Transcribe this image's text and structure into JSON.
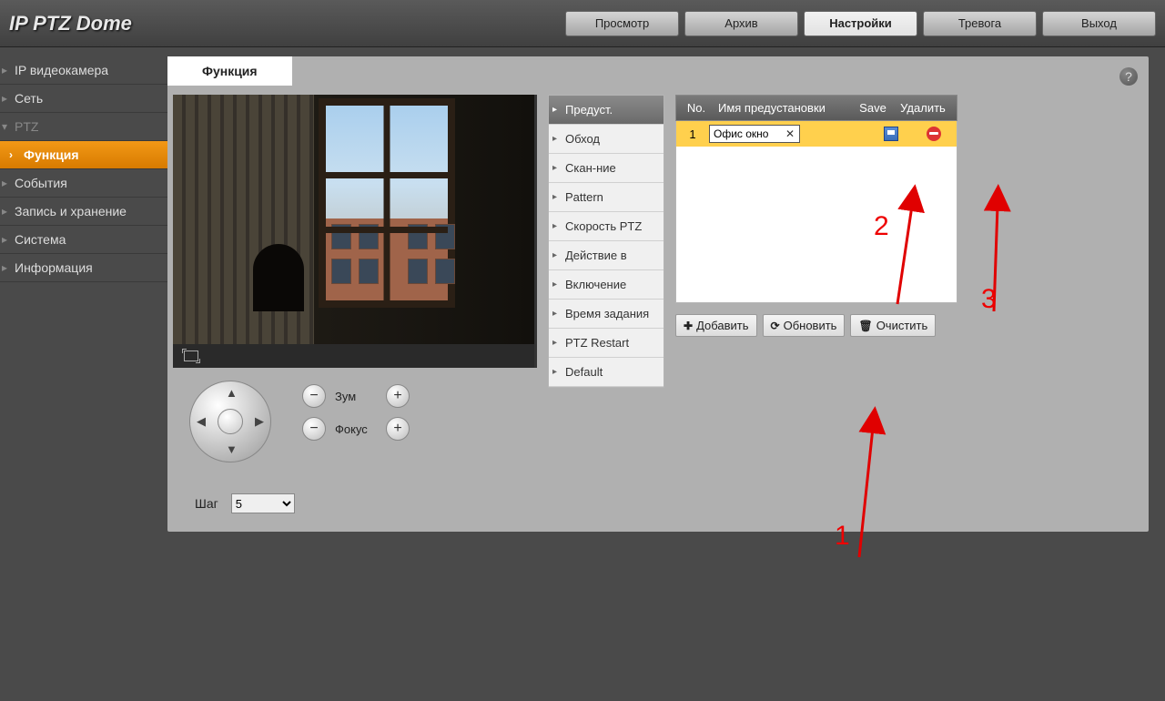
{
  "brand": "IP PTZ Dome",
  "topnav": {
    "preview": "Просмотр",
    "archive": "Архив",
    "settings": "Настройки",
    "alarm": "Тревога",
    "exit": "Выход"
  },
  "sidebar": {
    "camera": "IP видеокамера",
    "network": "Сеть",
    "ptz": "PTZ",
    "function": "Функция",
    "events": "События",
    "storage": "Запись и хранение",
    "system": "Система",
    "info": "Информация"
  },
  "tab": {
    "function": "Функция"
  },
  "ptz_menu": {
    "preset": "Предуст.",
    "tour": "Обход",
    "scan": "Скан-ние",
    "pattern": "Pattern",
    "speed": "Скорость PTZ",
    "action": "Действие в",
    "enable": "Включение",
    "timetask": "Время задания",
    "restart": "PTZ Restart",
    "default": "Default"
  },
  "controls": {
    "zoom": "Зум",
    "focus": "Фокус",
    "step": "Шаг",
    "step_value": "5"
  },
  "preset_table": {
    "headers": {
      "no": "No.",
      "name": "Имя предустановки",
      "save": "Save",
      "delete": "Удалить"
    },
    "rows": [
      {
        "no": "1",
        "name": "Офис окно"
      }
    ]
  },
  "buttons": {
    "add": "Добавить",
    "refresh": "Обновить",
    "clear": "Очистить"
  },
  "annotations": {
    "a1": "1",
    "a2": "2",
    "a3": "3"
  }
}
